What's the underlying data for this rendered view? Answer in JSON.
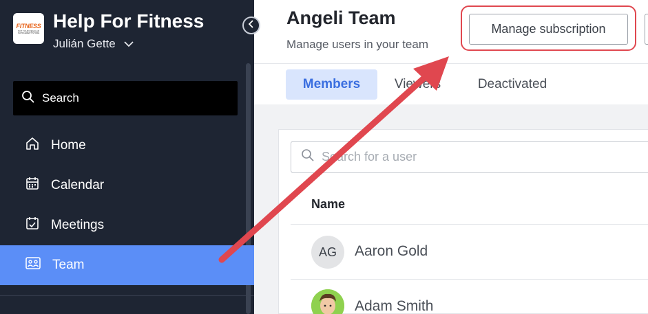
{
  "sidebar": {
    "logo": {
      "brand": "FITNESS",
      "tagline": "NOT YOUR REGULAR SUPPLEMENT STORE"
    },
    "org_name": "Help For Fitness",
    "user_name": "Julián Gette",
    "search_label": "Search",
    "items": [
      {
        "label": "Home",
        "icon": "home-icon"
      },
      {
        "label": "Calendar",
        "icon": "calendar-icon"
      },
      {
        "label": "Meetings",
        "icon": "meetings-icon"
      },
      {
        "label": "Team",
        "icon": "team-icon",
        "active": true
      }
    ]
  },
  "header": {
    "title": "Angeli Team",
    "subtitle": "Manage users in your team",
    "manage_button": "Manage subscription"
  },
  "tabs": [
    {
      "label": "Members",
      "active": true
    },
    {
      "label": "Viewers"
    },
    {
      "label": "Deactivated"
    }
  ],
  "members": {
    "search_placeholder": "Search for a user",
    "column_name": "Name",
    "rows": [
      {
        "initials": "AG",
        "name": "Aaron Gold"
      },
      {
        "initials": "",
        "name": "Adam Smith"
      }
    ]
  },
  "colors": {
    "sidebar_bg": "#1e2533",
    "active_nav": "#5b8ef7",
    "active_tab_bg": "#d9e5fd",
    "annotation_red": "#e0474f"
  }
}
